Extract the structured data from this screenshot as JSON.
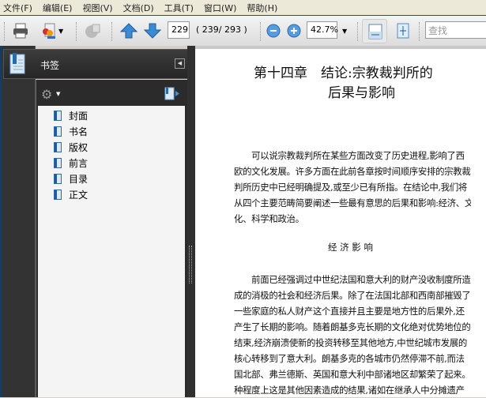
{
  "menu": [
    "文件(F)",
    "编辑(E)",
    "视图(V)",
    "文档(D)",
    "工具(T)",
    "窗口(W)",
    "帮助(H)"
  ],
  "toolbar": {
    "page_value": "229",
    "page_count": "( 239∕ 293 )",
    "zoom_value": "42.7%",
    "search_placeholder": "查找"
  },
  "panel": {
    "title": "书签",
    "bookmarks": [
      "封面",
      "书名",
      "版权",
      "前言",
      "目录",
      "正文"
    ]
  },
  "document": {
    "title_line1": "第十四章　结论:宗教裁判所的",
    "title_line2": "后果与影响",
    "para1": [
      "　　可以说宗教裁判所在某些方面改变了历史进程,影响了西",
      "欧的文化发展。许多方面在此前各章按时间顺序安排的宗教裁",
      "判所历史中已经明确提及,或至少已有所指。在结论中,我们将",
      "从四个主要范畴简要阐述一些最有意思的后果和影响:经济、文",
      "化、科学和政治。"
    ],
    "section": "经 济 影 响",
    "para2": [
      "　　前面已经强调过中世纪法国和意大利的财产没收制度所造",
      "成的消极的社会和经济后果。除了在法国北部和西南部摧毁了",
      "一些家庭的私人财产这个直接并且主要是地方性的后果外,还",
      "产生了长期的影响。随着朗基多克长期的文化绝对优势地位的",
      "结束,经济崩溃使新的投资转移至其他地方,中世纪城市发展的",
      "核心转移到了意大利。朗基多克的各城市仍然停滞不前,而法",
      "国北部、弗兰德斯、英国和意大利中部诸地区却繁荣了起来。某",
      "种程度上这是其他因素造成的结果,诸如在继承人中分摊遗产"
    ]
  }
}
